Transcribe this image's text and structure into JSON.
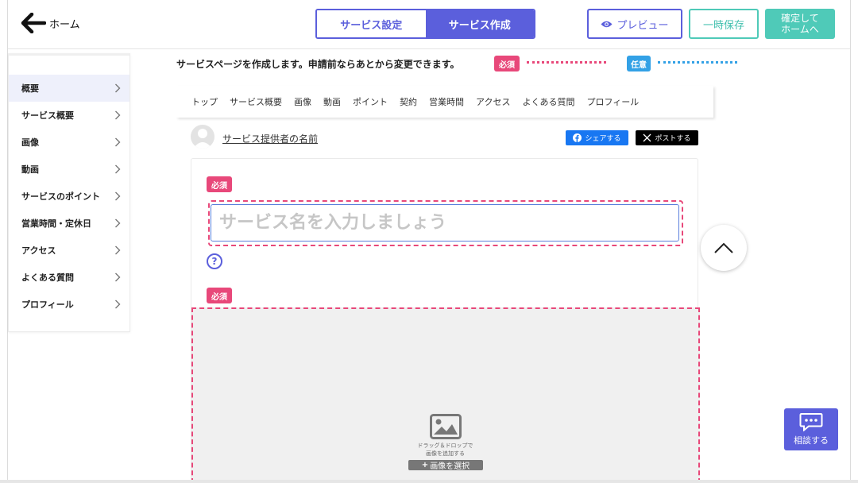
{
  "header": {
    "home_label": "ホーム",
    "tabs": [
      {
        "label": "サービス設定",
        "active": false
      },
      {
        "label": "サービス作成",
        "active": true
      }
    ],
    "preview_label": "プレビュー",
    "save_label": "一時保存",
    "confirm_line1": "確定して",
    "confirm_line2": "ホームへ"
  },
  "sidebar": {
    "items": [
      {
        "label": "概要",
        "active": true
      },
      {
        "label": "サービス概要"
      },
      {
        "label": "画像"
      },
      {
        "label": "動画"
      },
      {
        "label": "サービスのポイント"
      },
      {
        "label": "営業時間・定休日"
      },
      {
        "label": "アクセス"
      },
      {
        "label": "よくある質問"
      },
      {
        "label": "プロフィール"
      }
    ]
  },
  "intro": {
    "text": "サービスページを作成します。申請前ならあとから変更できます。",
    "required_tag": "必須",
    "optional_tag": "任意"
  },
  "page_nav": [
    "トップ",
    "サービス概要",
    "画像",
    "動画",
    "ポイント",
    "契約",
    "営業時間",
    "アクセス",
    "よくある質問",
    "プロフィール"
  ],
  "provider": {
    "name": "サービス提供者の名前",
    "share_label": "シェアする",
    "post_label": "ポストする"
  },
  "form": {
    "required_badge": "必須",
    "service_name_placeholder": "サービス名を入力しましょう",
    "service_name_value": "",
    "help_symbol": "?",
    "image_badge": "必須",
    "drop_line1": "ドラッグ＆ドロップで",
    "drop_line2": "画像を追加する",
    "select_image_label": "画像を選択"
  },
  "floating": {
    "consult_label": "相談する"
  },
  "colors": {
    "accent": "#5b5fdc",
    "teal": "#4fcab8",
    "required": "#e8487a",
    "optional": "#33a1e6",
    "facebook": "#1877f2"
  }
}
